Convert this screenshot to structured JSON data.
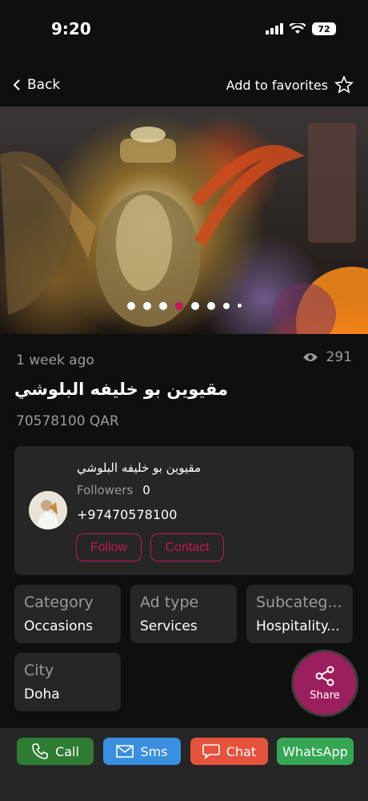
{
  "status_bar": {
    "time": "9:20",
    "battery": "72"
  },
  "nav": {
    "back_label": "Back",
    "favorites_label": "Add to favorites"
  },
  "gallery": {
    "total_slides": 8,
    "active_index": 3
  },
  "listing": {
    "posted": "1 week ago",
    "views": "291",
    "title": "مقيوين بو خليفه البلوشي",
    "price": "70578100 QAR"
  },
  "seller": {
    "name": "مقيوين بو خليفه البلوشي",
    "followers_label": "Followers",
    "followers_count": "0",
    "phone": "+97470578100",
    "follow_label": "Follow",
    "contact_label": "Contact"
  },
  "attributes": [
    {
      "label": "Category",
      "value": "Occasions"
    },
    {
      "label": "Ad type",
      "value": "Services"
    },
    {
      "label": "Subcateg...",
      "value": "Hospitality..."
    },
    {
      "label": "City",
      "value": "Doha"
    }
  ],
  "share": {
    "label": "Share"
  },
  "actions": {
    "call": "Call",
    "sms": "Sms",
    "chat": "Chat",
    "whatsapp": "WhatsApp"
  },
  "colors": {
    "accent": "#c2185b",
    "share_bg": "#9c1f5d",
    "call": "#2e7d32",
    "sms": "#3a8fe0",
    "chat": "#e6533c",
    "whatsapp": "#35a653"
  }
}
